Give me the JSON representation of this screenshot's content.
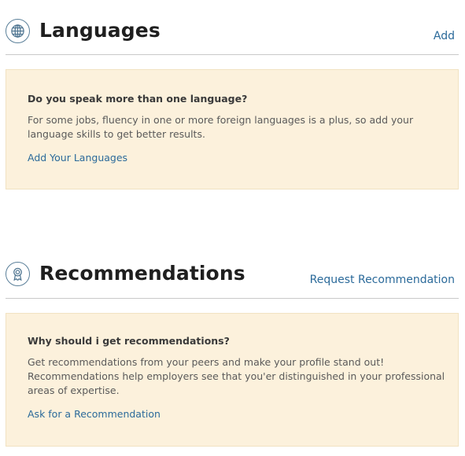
{
  "languages": {
    "title": "Languages",
    "action": "Add",
    "icon": "globe-icon",
    "box": {
      "question": "Do you speak more than one language?",
      "text": "For some jobs, fluency in one or more foreign languages is a plus, so add your language skills to get better results.",
      "link": "Add Your Languages"
    }
  },
  "recommendations": {
    "title": "Recommendations",
    "action": "Request Recommendation",
    "icon": "award-ribbon-icon",
    "box": {
      "question": "Why should i get recommendations?",
      "text": "Get recommendations from your peers and make your profile stand out! Recommendations help employers see that you'er distinguished in your professional areas of expertise.",
      "link": "Ask for a Recommendation"
    }
  },
  "colors": {
    "accent_link": "#2b6a9a",
    "icon_stroke": "#5a7f99",
    "box_background": "#fcf1dc",
    "divider": "#c9c9c9"
  }
}
